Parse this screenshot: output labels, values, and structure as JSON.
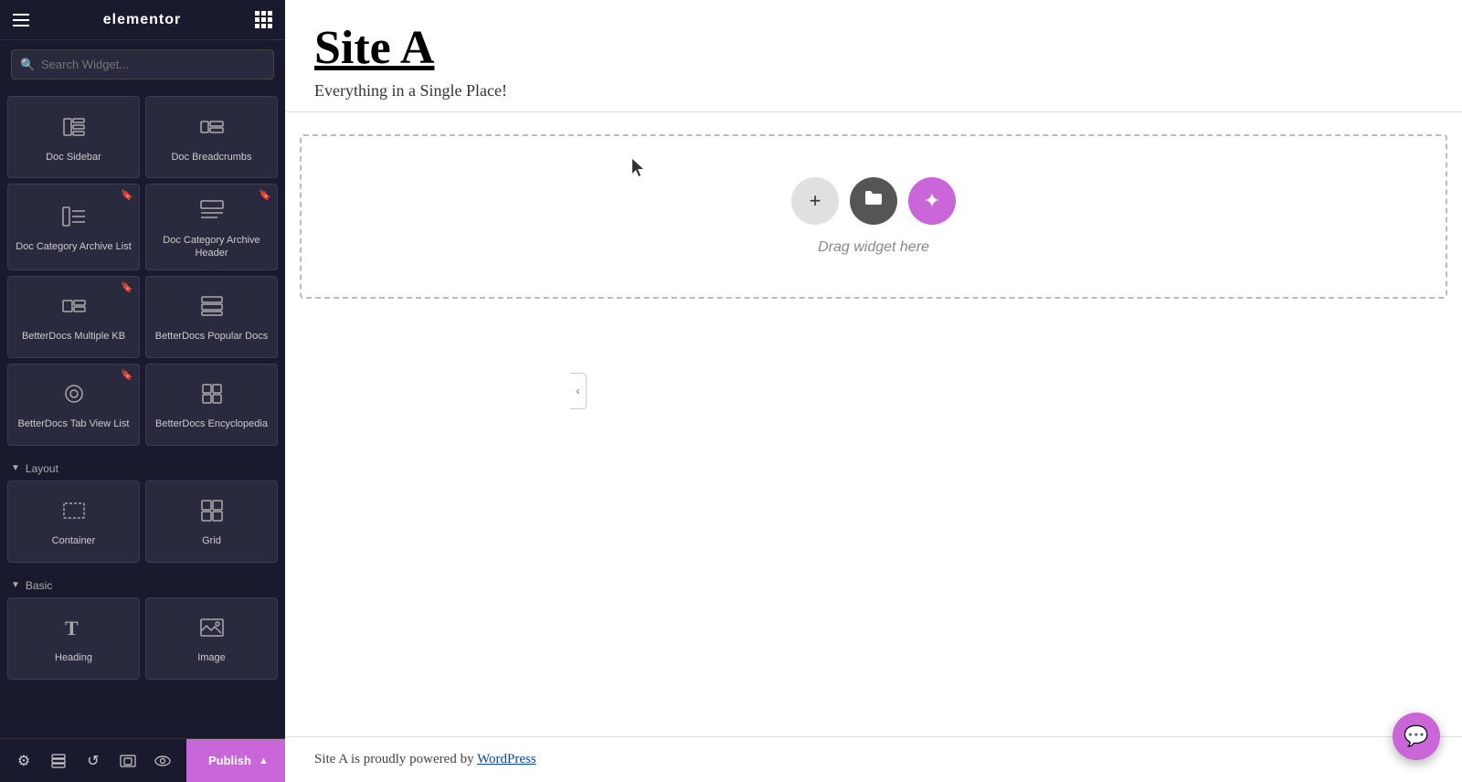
{
  "panel": {
    "logo": "elementor",
    "search": {
      "placeholder": "Search Widget..."
    },
    "widgets": [
      {
        "id": "doc-sidebar",
        "label": "Doc Sidebar",
        "icon": "⊞",
        "bookmarkable": false
      },
      {
        "id": "doc-breadcrumbs",
        "label": "Doc Breadcrumbs",
        "icon": "⊟",
        "bookmarkable": false
      },
      {
        "id": "doc-category-archive-list",
        "label": "Doc Category Archive List",
        "icon": "≡",
        "bookmarkable": true
      },
      {
        "id": "doc-category-archive-header",
        "label": "Doc Category Archive Header",
        "icon": "⊡",
        "bookmarkable": true
      },
      {
        "id": "betterdocs-multiple-kb",
        "label": "BetterDocs Multiple KB",
        "icon": "⊞",
        "bookmarkable": true
      },
      {
        "id": "betterdocs-popular-docs",
        "label": "BetterDocs Popular Docs",
        "icon": "≡",
        "bookmarkable": false
      },
      {
        "id": "betterdocs-tab-view-list",
        "label": "BetterDocs Tab View List",
        "icon": "◎",
        "bookmarkable": true
      },
      {
        "id": "betterdocs-encyclopedia",
        "label": "BetterDocs Encyclopedia",
        "icon": "⊞",
        "bookmarkable": false
      }
    ],
    "layout_section": "Layout",
    "layout_widgets": [
      {
        "id": "container",
        "label": "Container",
        "icon": "⊡"
      },
      {
        "id": "grid",
        "label": "Grid",
        "icon": "⊞"
      }
    ],
    "basic_section": "Basic",
    "basic_widgets": [
      {
        "id": "heading",
        "label": "Heading",
        "icon": "T"
      },
      {
        "id": "image",
        "label": "Image",
        "icon": "🖼"
      }
    ],
    "toolbar": {
      "settings_icon": "⚙",
      "layers_icon": "≡",
      "history_icon": "↺",
      "responsive_icon": "⊡",
      "view_icon": "👁",
      "publish_label": "Publish"
    }
  },
  "preview": {
    "site_title": "Site A",
    "site_tagline": "Everything in a Single Place!",
    "drop_zone_label": "Drag widget here",
    "footer_text": "Site A is proudly powered by ",
    "footer_link_text": "WordPress",
    "footer_link_url": "#"
  },
  "actions": {
    "add_btn_icon": "+",
    "folder_btn_icon": "📁",
    "ai_btn_icon": "✦",
    "collapse_icon": "‹",
    "chat_icon": "💬"
  }
}
